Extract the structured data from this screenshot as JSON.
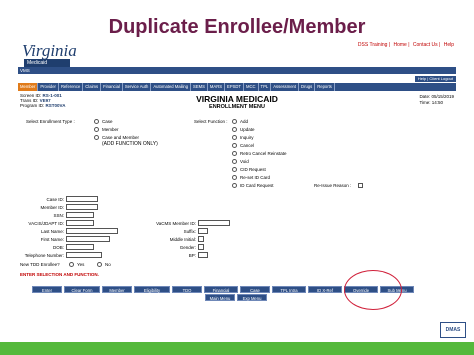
{
  "slide_title": "Duplicate Enrollee/Member",
  "header": {
    "logo_text": "Virginia",
    "logo_sub": "Medicaid",
    "links": [
      "DSS Training",
      "Home",
      "Contact Us",
      "Help"
    ],
    "bar1_text": "VMS",
    "bar2_links": [
      "Help",
      "Client Logout"
    ]
  },
  "menu": [
    "Member",
    "Provider",
    "Reference",
    "Claims",
    "Financial",
    "Service Auth",
    "Automated Mailing",
    "SEMS",
    "MARS",
    "EPSDT",
    "MCC",
    "TPL",
    "Assessment",
    "Drugs",
    "Reports"
  ],
  "ids": {
    "screen_label": "Screen ID:",
    "screen_value": "RS-1-001",
    "trans_label": "Trans ID:",
    "trans_value": "VE97",
    "program_label": "Program ID:",
    "program_value": "RST00VA"
  },
  "system_title": "VIRGINIA MEDICAID",
  "menu_title": "ENROLLMENT MENU",
  "date": {
    "date_label": "Date:",
    "date_value": "05/15/2019",
    "time_label": "Time:",
    "time_value": "14:50"
  },
  "enrollment_type": {
    "label": "Select Enrollment Type :",
    "options": [
      "Case",
      "Member",
      "Case and Member"
    ],
    "note": "(ADD FUNCTION ONLY)"
  },
  "function": {
    "label": "Select Function :",
    "options": [
      "Add",
      "Update",
      "Inquiry",
      "Cancel",
      "Retro Cancel Reinstate",
      "Void",
      "CID Request",
      "Re-set ID Card",
      "ID Card Request"
    ],
    "reissue_label": "Re-Issue Reason :"
  },
  "fields_left": [
    "Case ID:",
    "Member ID:",
    "SSN:",
    "VACIS/JDAPT ID:",
    "Last Name:",
    "First Name:",
    "DOB:",
    "Telephone Number:"
  ],
  "fields_right": [
    "VaCMS Member ID:",
    "Suffix:",
    "Middle Initial:",
    "Gender:",
    "BP:"
  ],
  "tdd": {
    "label": "New TDD Enrollee?",
    "yes": "Yes",
    "no": "No"
  },
  "warning": "ENTER SELECTION AND FUNCTION.",
  "buttons": [
    "Enter",
    "Clear Form",
    "Member",
    "Eligibility",
    "TDO",
    "Financial",
    "Case",
    "TPL Intra",
    "ID X-Ref",
    "Override",
    "Sub Menu"
  ],
  "buttons2": [
    "Main Menu",
    "Exp Menu"
  ],
  "dmas_logo": "DMAS",
  "colors": {
    "title": "#6b1e4a",
    "nav": "#2e4f86",
    "footer": "#55b93c",
    "highlight_circle": "#d0203a"
  }
}
